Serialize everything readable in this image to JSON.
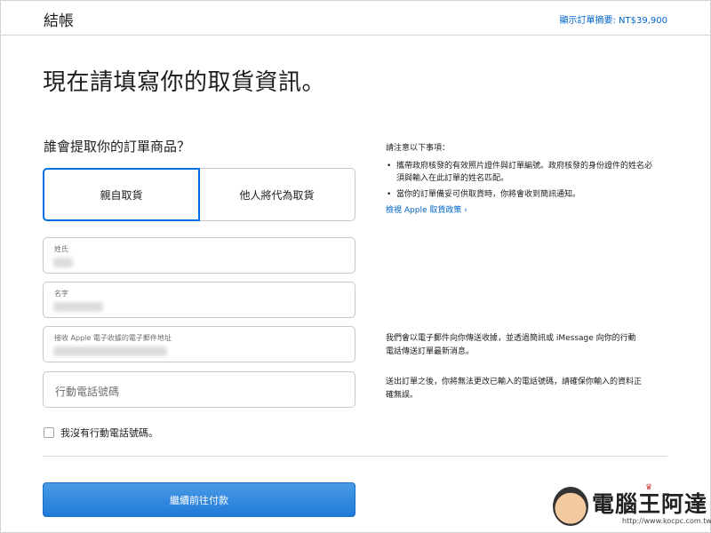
{
  "header": {
    "title": "結帳",
    "order_summary": "顯示訂單摘要: NT$39,900"
  },
  "main": {
    "headline": "現在請填寫你的取貨資訊。",
    "question": "誰會提取你的訂單商品？",
    "pickup_options": [
      {
        "label": "親自取貨",
        "selected": true
      },
      {
        "label": "他人將代為取貨",
        "selected": false
      }
    ],
    "fields": {
      "last_name_label": "姓氏",
      "first_name_label": "名字",
      "email_label": "接收 Apple 電子收據的電子郵件地址",
      "phone_placeholder": "行動電話號碼"
    },
    "no_phone_label": "我沒有行動電話號碼。",
    "no_phone_checked": false,
    "continue_button": "繼續前往付款"
  },
  "notes": {
    "title": "請注意以下事項：",
    "items": [
      "攜帶政府核發的有效照片證件與訂單編號。政府核發的身份證件的姓名必須與輸入在此訂單的姓名匹配。",
      "當你的訂單備妥可供取貨時，你將會收到簡訊通知。"
    ],
    "policy_link": "檢視 Apple 取貨政策 ›",
    "email_hint": "我們會以電子郵件向你傳送收據，並透過簡訊或 iMessage 向你的行動電話傳送訂單最新消息。",
    "phone_hint": "送出訂單之後，你將無法更改已輸入的電話號碼，請確保你輸入的資料正確無誤。"
  },
  "watermark": {
    "text": "電腦王阿達",
    "url": "http://www.kocpc.com.tw"
  },
  "colors": {
    "accent": "#0071e3",
    "link": "#0066cc",
    "button": "#2a7fd9"
  }
}
